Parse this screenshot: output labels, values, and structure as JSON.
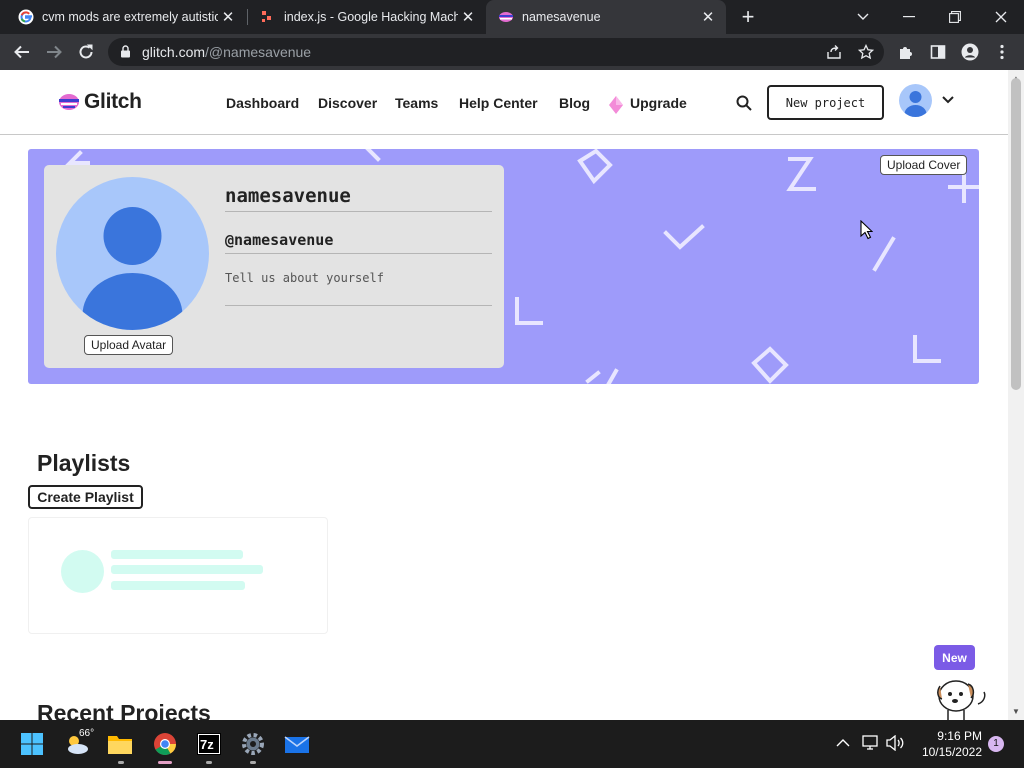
{
  "browser": {
    "tabs": [
      {
        "title": "cvm mods are extremely autistic",
        "icon": "google-icon"
      },
      {
        "title": "index.js - Google Hacking Machine",
        "icon": "glitch-editor-icon"
      },
      {
        "title": "namesavenue",
        "icon": "glitch-icon"
      }
    ],
    "url_host": "glitch.com",
    "url_path": "/@namesavenue"
  },
  "header": {
    "logo_text": "Glitch",
    "nav": [
      "Dashboard",
      "Discover",
      "Teams",
      "Help Center",
      "Blog",
      "Upgrade"
    ],
    "new_project_label": "New project"
  },
  "profile": {
    "upload_cover_label": "Upload Cover",
    "upload_avatar_label": "Upload Avatar",
    "name": "namesavenue",
    "login": "@namesavenue",
    "bio_placeholder": "Tell us about yourself",
    "cover_color": "#9e9bfa"
  },
  "playlists": {
    "title": "Playlists",
    "create_label": "Create Playlist"
  },
  "recent_projects": {
    "title": "Recent Projects"
  },
  "widget": {
    "new_label": "New"
  },
  "taskbar": {
    "weather": "66°",
    "time": "9:16 PM",
    "date": "10/15/2022",
    "notification_count": "1"
  }
}
